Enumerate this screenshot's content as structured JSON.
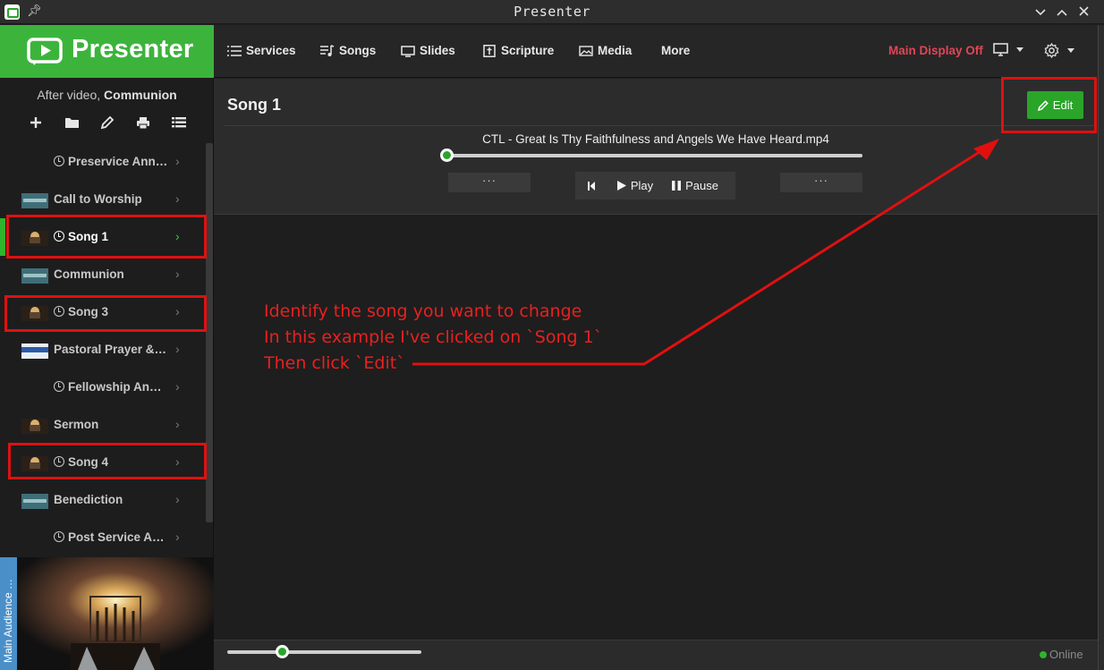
{
  "window": {
    "title": "Presenter"
  },
  "app": {
    "logo_text": "Presenter"
  },
  "service": {
    "prefix": "After video,",
    "name": "Communion"
  },
  "toolbar_icons": [
    "plus-icon",
    "folder-icon",
    "pencil-icon",
    "printer-icon",
    "list-icon"
  ],
  "items": [
    {
      "label": "Preservice Ann…",
      "clock": true,
      "thumb": null
    },
    {
      "label": "Call to Worship",
      "clock": false,
      "thumb": "teal"
    },
    {
      "label": "Song 1",
      "clock": true,
      "thumb": "worship",
      "active": true
    },
    {
      "label": "Communion",
      "clock": false,
      "thumb": "teal"
    },
    {
      "label": "Song 3",
      "clock": true,
      "thumb": "worship"
    },
    {
      "label": "Pastoral Prayer &…",
      "clock": false,
      "thumb": "blue"
    },
    {
      "label": "Fellowship An…",
      "clock": true,
      "thumb": null
    },
    {
      "label": "Sermon",
      "clock": false,
      "thumb": "worship"
    },
    {
      "label": "Song 4",
      "clock": true,
      "thumb": "worship"
    },
    {
      "label": "Benediction",
      "clock": false,
      "thumb": "teal"
    },
    {
      "label": "Post Service A…",
      "clock": true,
      "thumb": null
    }
  ],
  "preview": {
    "tab_label": "Main Audience …"
  },
  "nav": {
    "services": "Services",
    "songs": "Songs",
    "slides": "Slides",
    "scripture": "Scripture",
    "media": "Media",
    "more": "More",
    "display_status": "Main Display Off"
  },
  "panel": {
    "title": "Song 1",
    "edit_label": "Edit",
    "media_filename": "CTL - Great Is Thy Faithfulness and Angels We Have Heard.mp4",
    "media_progress": 0,
    "more_label": "···",
    "play_label": "Play",
    "pause_label": "Pause"
  },
  "annotation": {
    "line1": "Identify the song you want to change",
    "line2": "In this example I've clicked on `Song 1`",
    "line3": "Then click `Edit`"
  },
  "footer": {
    "volume_fraction": 0.28,
    "status": "Online"
  },
  "colors": {
    "accent_green": "#3cb43c",
    "alert_red": "#e24556",
    "annotation_red": "#e01010"
  }
}
